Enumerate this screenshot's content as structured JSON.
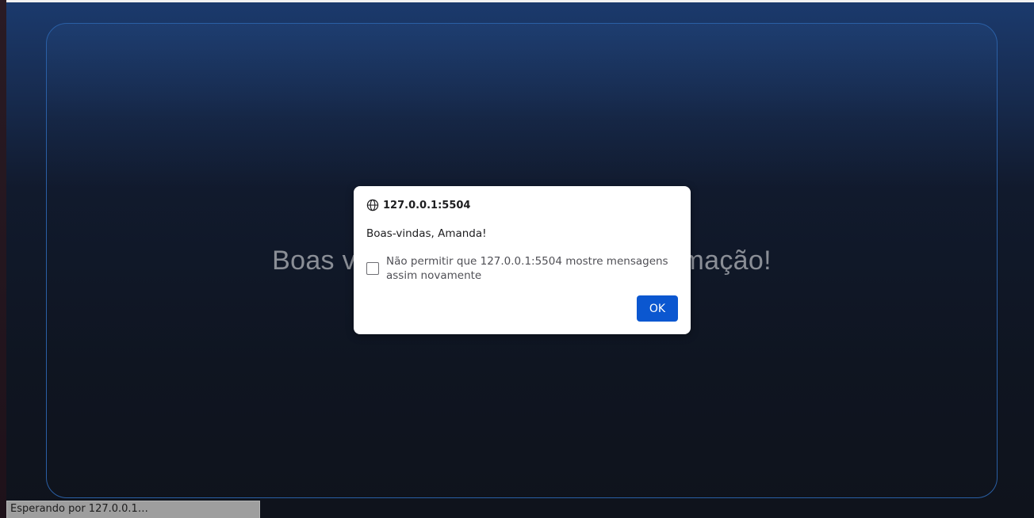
{
  "page": {
    "hero_title": "Boas vindas à plataforma de informação!"
  },
  "dialog": {
    "origin": "127.0.0.1:5504",
    "message": "Boas-vindas, Amanda!",
    "checkbox_label": "Não permitir que 127.0.0.1:5504 mostre mensagens assim novamente",
    "checkbox_checked": false,
    "ok_label": "OK",
    "icon": "globe-icon"
  },
  "status_bar": {
    "text": "Esperando por 127.0.0.1…"
  },
  "colors": {
    "ok_button": "#0b57d0",
    "card_border": "#2a5fa5",
    "background_top": "#1b3a6d",
    "background_bottom": "#0f131c"
  }
}
